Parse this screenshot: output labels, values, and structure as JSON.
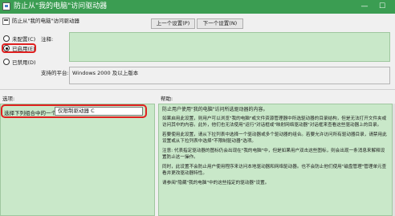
{
  "window": {
    "title": "防止从\"我的电脑\"访问驱动器",
    "minimize_symbol": "—",
    "maximize_symbol": "☐"
  },
  "header": {
    "policy_name": "防止从\"我的电脑\"访问驱动器",
    "prev_button": "上一个设置(P)",
    "next_button": "下一个设置(N)"
  },
  "state": {
    "options": [
      {
        "label": "未配置(C)",
        "checked": false
      },
      {
        "label": "已启用(E)",
        "checked": true
      },
      {
        "label": "已禁用(D)",
        "checked": false
      }
    ]
  },
  "comment": {
    "label": "注释:",
    "value": ""
  },
  "platform": {
    "label": "支持的平台:",
    "value": "Windows 2000 及以上版本"
  },
  "sections": {
    "options_label": "选项:",
    "help_label": "帮助:"
  },
  "options_panel": {
    "drive_label": "选择下列组合中的一个",
    "drive_value": "仅限制驱动器 C"
  },
  "help": {
    "paragraphs": [
      "防止用户使用\"我的电脑\"访问所选驱动器的内容。",
      "如果启用此设置，则用户可以浏览\"我的电脑\"或文件资源管理器中所选驱动器的目录结构，但是无法打开文件夹或访问其中的内容。此外，他们也无法使用\"运行\"对话框或\"映射网络驱动器\"对话框来查看这些驱动器上的目录。",
      "若要使用此设置，请从下拉列表中选择一个驱动器或多个驱动器的组合。若要允许访问所有驱动器目录，请禁用此设置或从下拉列表中选择\"不限制驱动器\"选项。",
      "注意: 代表指定驱动器的图标仍会出现在\"我的电脑\"中，但是如果用户双击这些图标，则会出现一条消息来解释设置防止这一操作。",
      "同时，此设置不会防止用户使用程序来访问本地驱动器和网络驱动器。也不会防止他们使用\"磁盘管理\"管理单元查看并更改驱动器特性。",
      "请参阅\"隐藏\"我的电脑\"中的这些指定的驱动器\"设置。"
    ]
  },
  "colors": {
    "titlebar": "#3b9d52",
    "panel_green": "#c9e8c9",
    "highlight": "#e02020"
  },
  "icons": [
    "app-icon",
    "policy-icon"
  ]
}
